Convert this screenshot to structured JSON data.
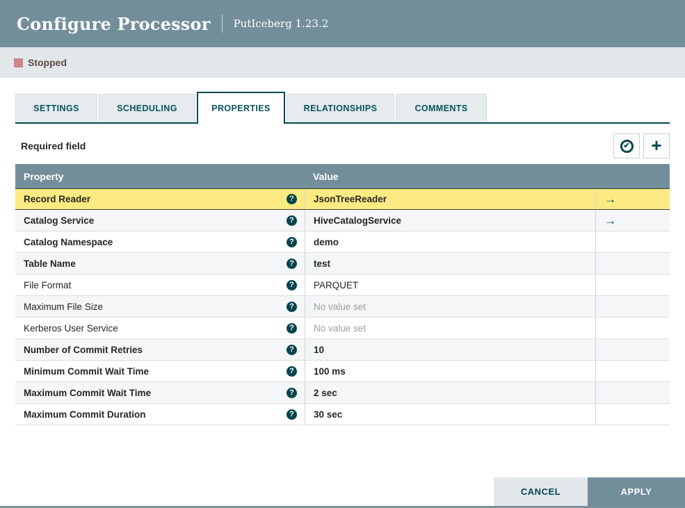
{
  "dialog": {
    "title": "Configure Processor",
    "processor": "PutIceberg 1.23.2",
    "status": {
      "label": "Stopped",
      "color": "#ce8488"
    },
    "tabs": [
      {
        "label": "SETTINGS",
        "active": false
      },
      {
        "label": "SCHEDULING",
        "active": false
      },
      {
        "label": "PROPERTIES",
        "active": true
      },
      {
        "label": "RELATIONSHIPS",
        "active": false
      },
      {
        "label": "COMMENTS",
        "active": false
      }
    ],
    "properties_tab": {
      "required_field_label": "Required field",
      "toolbar": {
        "verify_icon": "check-circle-icon",
        "verify_glyph": "✔",
        "add_icon": "plus-icon",
        "add_glyph": "+"
      },
      "table": {
        "columns": [
          "Property",
          "Value"
        ],
        "help_glyph": "?",
        "goto_glyph": "→",
        "rows": [
          {
            "property": "Record Reader",
            "value": "JsonTreeReader",
            "required": true,
            "selected": true,
            "empty": false,
            "goto": true
          },
          {
            "property": "Catalog Service",
            "value": "HiveCatalogService",
            "required": true,
            "selected": false,
            "empty": false,
            "goto": true
          },
          {
            "property": "Catalog Namespace",
            "value": "demo",
            "required": true,
            "selected": false,
            "empty": false,
            "goto": false
          },
          {
            "property": "Table Name",
            "value": "test",
            "required": true,
            "selected": false,
            "empty": false,
            "goto": false
          },
          {
            "property": "File Format",
            "value": "PARQUET",
            "required": false,
            "selected": false,
            "empty": false,
            "goto": false
          },
          {
            "property": "Maximum File Size",
            "value": "No value set",
            "required": false,
            "selected": false,
            "empty": true,
            "goto": false
          },
          {
            "property": "Kerberos User Service",
            "value": "No value set",
            "required": false,
            "selected": false,
            "empty": true,
            "goto": false
          },
          {
            "property": "Number of Commit Retries",
            "value": "10",
            "required": true,
            "selected": false,
            "empty": false,
            "goto": false
          },
          {
            "property": "Minimum Commit Wait Time",
            "value": "100 ms",
            "required": true,
            "selected": false,
            "empty": false,
            "goto": false
          },
          {
            "property": "Maximum Commit Wait Time",
            "value": "2 sec",
            "required": true,
            "selected": false,
            "empty": false,
            "goto": false
          },
          {
            "property": "Maximum Commit Duration",
            "value": "30 sec",
            "required": true,
            "selected": false,
            "empty": false,
            "goto": false
          }
        ]
      }
    },
    "footer": {
      "cancel_label": "CANCEL",
      "apply_label": "APPLY"
    },
    "colors": {
      "header_bg": "#728e9b",
      "status_bar_bg": "#e2e7e9",
      "accent_teal": "#07454d",
      "tab_border": "#004849",
      "selected_row_bg": "#fcea82",
      "alt_row_bg": "#f4f6f7"
    }
  }
}
